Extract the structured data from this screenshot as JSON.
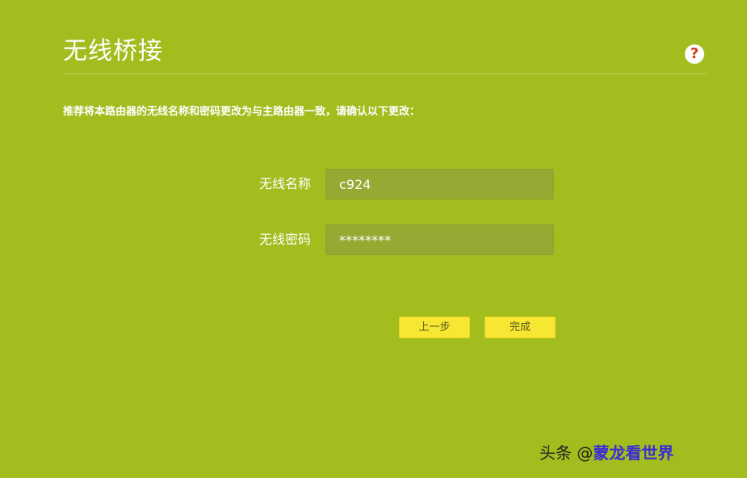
{
  "page": {
    "title": "无线桥接",
    "help_icon_glyph": "?",
    "description": "推荐将本路由器的无线名称和密码更改为与主路由器一致，请确认以下更改："
  },
  "form": {
    "ssid_label": "无线名称",
    "ssid_value": "c924",
    "password_label": "无线密码",
    "password_value": "********"
  },
  "buttons": {
    "back_label": "上一步",
    "finish_label": "完成"
  },
  "watermark": {
    "prefix": "头条 @",
    "brand": "蒙龙看世界"
  },
  "colors": {
    "background": "#a3bd1f",
    "input_background": "#95aa33",
    "button_background": "#f7e733",
    "help_icon": "#d33b1f"
  },
  "icons": {
    "help": "question-circle-icon"
  }
}
